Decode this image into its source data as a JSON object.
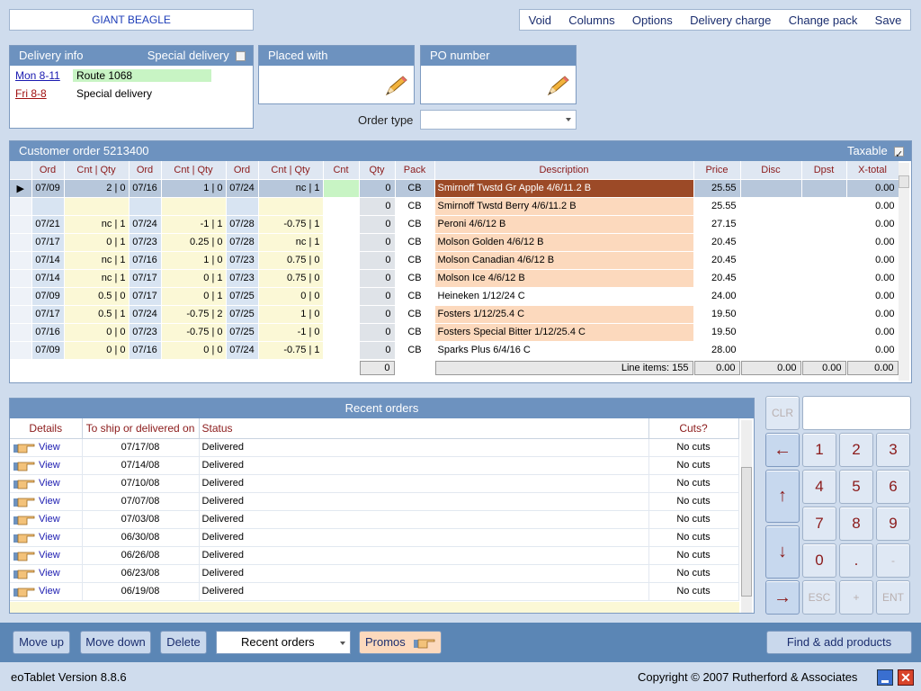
{
  "customer_name": "GIANT BEAGLE",
  "top_menu": [
    "Void",
    "Columns",
    "Options",
    "Delivery charge",
    "Change pack",
    "Save"
  ],
  "delivery_info": {
    "title": "Delivery info",
    "special_label": "Special delivery",
    "special_checked": false,
    "rows": [
      {
        "day": "Mon 8-11",
        "value": "Route 1068"
      },
      {
        "day": "Fri 8-8",
        "value": "Special delivery"
      }
    ]
  },
  "placed_with": {
    "title": "Placed with",
    "value": ""
  },
  "po_number": {
    "title": "PO number",
    "value": ""
  },
  "order_type": {
    "label": "Order type",
    "value": ""
  },
  "customer_order": {
    "title": "Customer order 5213400",
    "taxable_label": "Taxable",
    "taxable_checked": true,
    "columns": [
      "Ord",
      "Cnt | Qty",
      "Ord",
      "Cnt | Qty",
      "Ord",
      "Cnt | Qty",
      "Cnt",
      "Qty",
      "Pack",
      "Description",
      "Price",
      "Disc",
      "Dpst",
      "X-total"
    ],
    "rows": [
      {
        "o1": "07/09",
        "c1": "2 | 0",
        "o2": "07/16",
        "c2": "1 | 0",
        "o3": "07/24",
        "c3": "nc | 1",
        "cnt": "",
        "qty": "0",
        "pack": "CB",
        "desc": "Smirnoff Twstd Gr Apple 4/6/11.2 B",
        "price": "25.55",
        "disc": "",
        "dpst": "",
        "xt": "0.00"
      },
      {
        "o1": "",
        "c1": "",
        "o2": "",
        "c2": "",
        "o3": "",
        "c3": "",
        "cnt": "",
        "qty": "0",
        "pack": "CB",
        "desc": "Smirnoff Twstd Berry 4/6/11.2 B",
        "price": "25.55",
        "disc": "",
        "dpst": "",
        "xt": "0.00"
      },
      {
        "o1": "07/21",
        "c1": "nc | 1",
        "o2": "07/24",
        "c2": "-1 | 1",
        "o3": "07/28",
        "c3": "-0.75 | 1",
        "cnt": "",
        "qty": "0",
        "pack": "CB",
        "desc": "Peroni 4/6/12 B",
        "price": "27.15",
        "disc": "",
        "dpst": "",
        "xt": "0.00"
      },
      {
        "o1": "07/17",
        "c1": "0 | 1",
        "o2": "07/23",
        "c2": "0.25 | 0",
        "o3": "07/28",
        "c3": "nc | 1",
        "cnt": "",
        "qty": "0",
        "pack": "CB",
        "desc": "Molson Golden 4/6/12 B",
        "price": "20.45",
        "disc": "",
        "dpst": "",
        "xt": "0.00"
      },
      {
        "o1": "07/14",
        "c1": "nc | 1",
        "o2": "07/16",
        "c2": "1 | 0",
        "o3": "07/23",
        "c3": "0.75 | 0",
        "cnt": "",
        "qty": "0",
        "pack": "CB",
        "desc": "Molson Canadian 4/6/12 B",
        "price": "20.45",
        "disc": "",
        "dpst": "",
        "xt": "0.00"
      },
      {
        "o1": "07/14",
        "c1": "nc | 1",
        "o2": "07/17",
        "c2": "0 | 1",
        "o3": "07/23",
        "c3": "0.75 | 0",
        "cnt": "",
        "qty": "0",
        "pack": "CB",
        "desc": "Molson Ice 4/6/12 B",
        "price": "20.45",
        "disc": "",
        "dpst": "",
        "xt": "0.00"
      },
      {
        "o1": "07/09",
        "c1": "0.5 | 0",
        "o2": "07/17",
        "c2": "0 | 1",
        "o3": "07/25",
        "c3": "0 | 0",
        "cnt": "",
        "qty": "0",
        "pack": "CB",
        "desc": "Heineken 1/12/24 C",
        "price": "24.00",
        "disc": "",
        "dpst": "",
        "xt": "0.00"
      },
      {
        "o1": "07/17",
        "c1": "0.5 | 1",
        "o2": "07/24",
        "c2": "-0.75 | 2",
        "o3": "07/25",
        "c3": "1 | 0",
        "cnt": "",
        "qty": "0",
        "pack": "CB",
        "desc": "Fosters 1/12/25.4 C",
        "price": "19.50",
        "disc": "",
        "dpst": "",
        "xt": "0.00"
      },
      {
        "o1": "07/16",
        "c1": "0 | 0",
        "o2": "07/23",
        "c2": "-0.75 | 0",
        "o3": "07/25",
        "c3": "-1 | 0",
        "cnt": "",
        "qty": "0",
        "pack": "CB",
        "desc": "Fosters Special Bitter 1/12/25.4 C",
        "price": "19.50",
        "disc": "",
        "dpst": "",
        "xt": "0.00"
      },
      {
        "o1": "07/09",
        "c1": "0 | 0",
        "o2": "07/16",
        "c2": "0 | 0",
        "o3": "07/24",
        "c3": "-0.75 | 1",
        "cnt": "",
        "qty": "0",
        "pack": "CB",
        "desc": "Sparks Plus 6/4/16 C",
        "price": "28.00",
        "disc": "",
        "dpst": "",
        "xt": "0.00"
      }
    ],
    "footer": {
      "qty_total": "0",
      "line_items_label": "Line items:",
      "line_items": "155",
      "price_total": "0.00",
      "disc_total": "0.00",
      "dpst_total": "0.00",
      "xtotal": "0.00"
    }
  },
  "recent_orders": {
    "title": "Recent orders",
    "columns": [
      "Details",
      "To ship or delivered on",
      "Status",
      "Cuts?"
    ],
    "view_label": "View",
    "rows": [
      {
        "date": "07/17/08",
        "status": "Delivered",
        "cuts": "No cuts"
      },
      {
        "date": "07/14/08",
        "status": "Delivered",
        "cuts": "No cuts"
      },
      {
        "date": "07/10/08",
        "status": "Delivered",
        "cuts": "No cuts"
      },
      {
        "date": "07/07/08",
        "status": "Delivered",
        "cuts": "No cuts"
      },
      {
        "date": "07/03/08",
        "status": "Delivered",
        "cuts": "No cuts"
      },
      {
        "date": "06/30/08",
        "status": "Delivered",
        "cuts": "No cuts"
      },
      {
        "date": "06/26/08",
        "status": "Delivered",
        "cuts": "No cuts"
      },
      {
        "date": "06/23/08",
        "status": "Delivered",
        "cuts": "No cuts"
      },
      {
        "date": "06/19/08",
        "status": "Delivered",
        "cuts": "No cuts"
      }
    ]
  },
  "keypad": {
    "clr": "CLR",
    "esc": "ESC",
    "plus": "+",
    "ent": "ENT",
    "dot": ".",
    "minus": "-",
    "display": ""
  },
  "bottom_buttons": {
    "move_up": "Move up",
    "move_down": "Move down",
    "delete": "Delete",
    "view_select": "Recent orders",
    "promos": "Promos",
    "find_add": "Find & add products"
  },
  "status_bar": {
    "version": "eoTablet Version 8.8.6",
    "copyright": "Copyright © 2007 Rutherford & Associates"
  },
  "colors": {
    "header_blue": "#6d92bf",
    "selected_desc": "#9c4a27",
    "desc_orange": "#fcd9bd",
    "cnt_qty_yellow": "#fbf8d6",
    "green": "#c8f4c4",
    "key_red": "#8b1a1a"
  }
}
